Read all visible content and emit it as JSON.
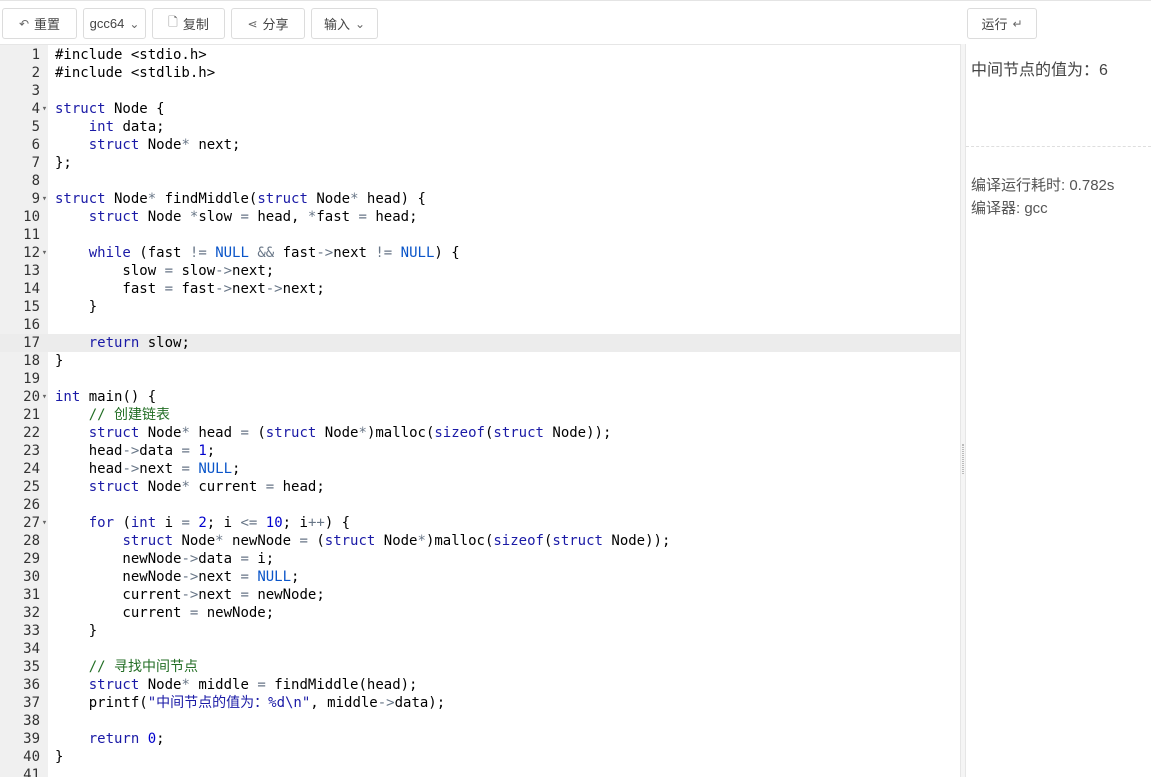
{
  "toolbar": {
    "reset_label": "重置",
    "compiler_label": "gcc64",
    "copy_label": "复制",
    "share_label": "分享",
    "input_label": "输入",
    "run_label": "运行"
  },
  "editor": {
    "active_line": 17,
    "folds": [
      4,
      9,
      12,
      20,
      27
    ],
    "lines": [
      "#include <stdio.h>",
      "#include <stdlib.h>",
      "",
      "struct Node {",
      "    int data;",
      "    struct Node* next;",
      "};",
      "",
      "struct Node* findMiddle(struct Node* head) {",
      "    struct Node *slow = head, *fast = head;",
      "",
      "    while (fast != NULL && fast->next != NULL) {",
      "        slow = slow->next;",
      "        fast = fast->next->next;",
      "    }",
      "",
      "    return slow;",
      "}",
      "",
      "int main() {",
      "    // 创建链表",
      "    struct Node* head = (struct Node*)malloc(sizeof(struct Node));",
      "    head->data = 1;",
      "    head->next = NULL;",
      "    struct Node* current = head;",
      "",
      "    for (int i = 2; i <= 10; i++) {",
      "        struct Node* newNode = (struct Node*)malloc(sizeof(struct Node));",
      "        newNode->data = i;",
      "        newNode->next = NULL;",
      "        current->next = newNode;",
      "        current = newNode;",
      "    }",
      "",
      "    // 寻找中间节点",
      "    struct Node* middle = findMiddle(head);",
      "    printf(\"中间节点的值为：%d\\n\", middle->data);",
      "",
      "    return 0;",
      "}",
      ""
    ]
  },
  "output": {
    "result": "中间节点的值为：6",
    "time": "编译运行耗时: 0.782s",
    "compiler": "编译器: gcc"
  }
}
